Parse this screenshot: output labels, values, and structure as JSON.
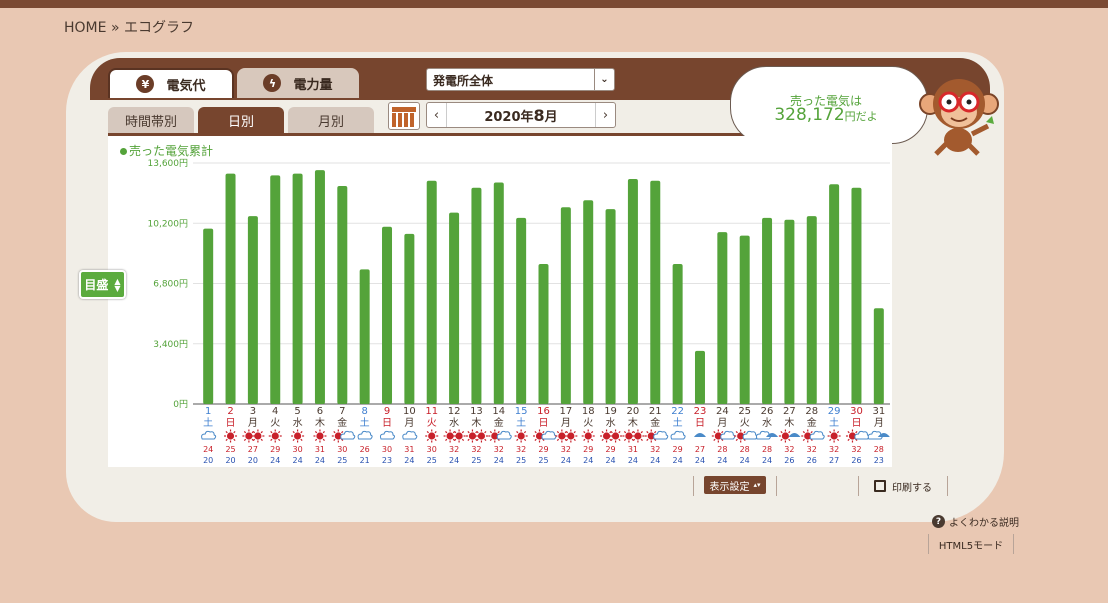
{
  "breadcrumb": {
    "home": "HOME",
    "sep": "»",
    "current": "エコグラフ"
  },
  "tabs": {
    "cost": {
      "icon": "yen-icon",
      "glyph": "¥",
      "label": "電気代"
    },
    "power": {
      "icon": "lightning-icon",
      "glyph": "ϟ",
      "label": "電力量"
    }
  },
  "plant_select": {
    "value": "発電所全体",
    "arrow": "⌄"
  },
  "subtabs": {
    "hourly": "時間帯別",
    "daily": "日別",
    "monthly": "月別"
  },
  "month_nav": {
    "prev": "‹",
    "next": "›",
    "year": "2020年",
    "month": "8",
    "month_unit": "月"
  },
  "sold_bubble": {
    "label": "売った電気は",
    "value": "328,172",
    "suffix": "円だよ"
  },
  "legend_label": "売った電気累計",
  "scale_button": {
    "label": "目盛",
    "up": "▲",
    "down": "▼"
  },
  "footer": {
    "display_settings": "表示設定",
    "print": "印刷する",
    "help": "よくわかる説明",
    "html5": "HTML5モード"
  },
  "colors": {
    "bar": "#54a33a",
    "brown": "#77452e",
    "weekday": "#4a3a30",
    "saturday": "#3f7fd0",
    "sunday_holiday": "#c8202a",
    "high_temp": "#c8202a",
    "low_temp": "#2a52b0"
  },
  "chart_data": {
    "type": "bar",
    "title": "売った電気累計",
    "ylabel": "",
    "ylim": [
      0,
      13600
    ],
    "yticks": [
      "0円",
      "3,400円",
      "6,800円",
      "10,200円",
      "13,600円"
    ],
    "ytick_values": [
      0,
      3400,
      6800,
      10200,
      13600
    ],
    "grid": true,
    "categories": [
      "1",
      "2",
      "3",
      "4",
      "5",
      "6",
      "7",
      "8",
      "9",
      "10",
      "11",
      "12",
      "13",
      "14",
      "15",
      "16",
      "17",
      "18",
      "19",
      "20",
      "21",
      "22",
      "23",
      "24",
      "25",
      "26",
      "27",
      "28",
      "29",
      "30",
      "31"
    ],
    "weekdays": [
      "土",
      "日",
      "月",
      "火",
      "水",
      "木",
      "金",
      "土",
      "日",
      "月",
      "火",
      "水",
      "木",
      "金",
      "土",
      "日",
      "月",
      "火",
      "水",
      "木",
      "金",
      "土",
      "日",
      "月",
      "火",
      "水",
      "木",
      "金",
      "土",
      "日",
      "月"
    ],
    "day_type": [
      "sat",
      "sun",
      "wd",
      "wd",
      "wd",
      "wd",
      "wd",
      "sat",
      "sun",
      "wd",
      "hol",
      "wd",
      "wd",
      "wd",
      "sat",
      "sun",
      "wd",
      "wd",
      "wd",
      "wd",
      "wd",
      "sat",
      "sun",
      "wd",
      "wd",
      "wd",
      "wd",
      "wd",
      "sat",
      "sun",
      "wd"
    ],
    "weather": [
      "cloudy",
      "sunny",
      "sunny-sunny",
      "sunny",
      "sunny",
      "sunny",
      "sunny-cloudy",
      "cloudy",
      "cloudy",
      "cloudy",
      "sunny",
      "sunny-sunny",
      "sunny-sunny",
      "sunny-cloudy",
      "sunny",
      "sunny-cloudy",
      "sunny-sunny",
      "sunny",
      "sunny-sunny",
      "sunny-sunny",
      "sunny-cloudy",
      "cloudy",
      "rainy",
      "sunny-cloudy",
      "sunny-cloudy",
      "cloudy-rainy",
      "sunny-rainy",
      "sunny-cloudy",
      "sunny",
      "sunny-cloudy",
      "cloudy-rainy"
    ],
    "high_temps": [
      24,
      25,
      27,
      29,
      30,
      31,
      30,
      26,
      30,
      31,
      30,
      32,
      32,
      32,
      32,
      29,
      32,
      29,
      29,
      31,
      32,
      29,
      27,
      28,
      28,
      28,
      32,
      32,
      32,
      32,
      28
    ],
    "low_temps": [
      20,
      20,
      20,
      24,
      24,
      24,
      25,
      21,
      23,
      24,
      25,
      24,
      25,
      24,
      25,
      25,
      24,
      24,
      24,
      24,
      24,
      24,
      24,
      24,
      24,
      24,
      26,
      26,
      27,
      26,
      23
    ],
    "values": [
      9900,
      13000,
      10600,
      12900,
      13000,
      13200,
      12300,
      7600,
      10000,
      9600,
      12600,
      10800,
      12200,
      12500,
      10500,
      7900,
      11100,
      11500,
      11000,
      12700,
      12600,
      7900,
      3000,
      9700,
      9500,
      10500,
      10400,
      10600,
      12400,
      12200,
      5400
    ]
  }
}
